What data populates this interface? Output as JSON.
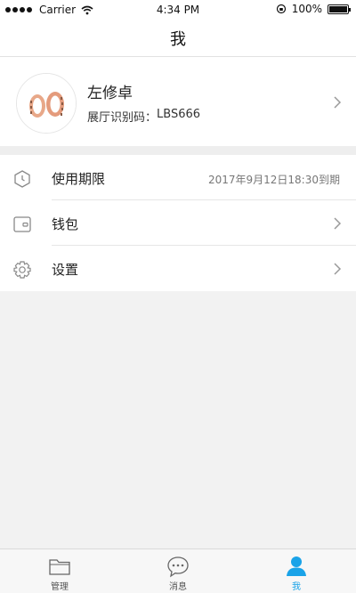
{
  "status_bar": {
    "carrier": "Carrier",
    "time": "4:34 PM",
    "battery": "100%"
  },
  "nav": {
    "title": "我"
  },
  "profile": {
    "name": "左修卓",
    "code_label": "展厅识别码：",
    "code_value": "LBS666"
  },
  "menu": {
    "items": [
      {
        "label": "使用期限",
        "value": "2017年9月12日18:30到期",
        "icon": "clock-shield-icon"
      },
      {
        "label": "钱包",
        "icon": "wallet-icon"
      },
      {
        "label": "设置",
        "icon": "gear-icon"
      }
    ]
  },
  "tabs": [
    {
      "label": "管理",
      "icon": "folder-icon",
      "active": false
    },
    {
      "label": "消息",
      "icon": "chat-bubble-icon",
      "active": false
    },
    {
      "label": "我",
      "icon": "person-icon",
      "active": true
    }
  ],
  "colors": {
    "accent": "#1aa3e8",
    "background": "#f2f2f2",
    "divider": "#e6e6e6"
  }
}
